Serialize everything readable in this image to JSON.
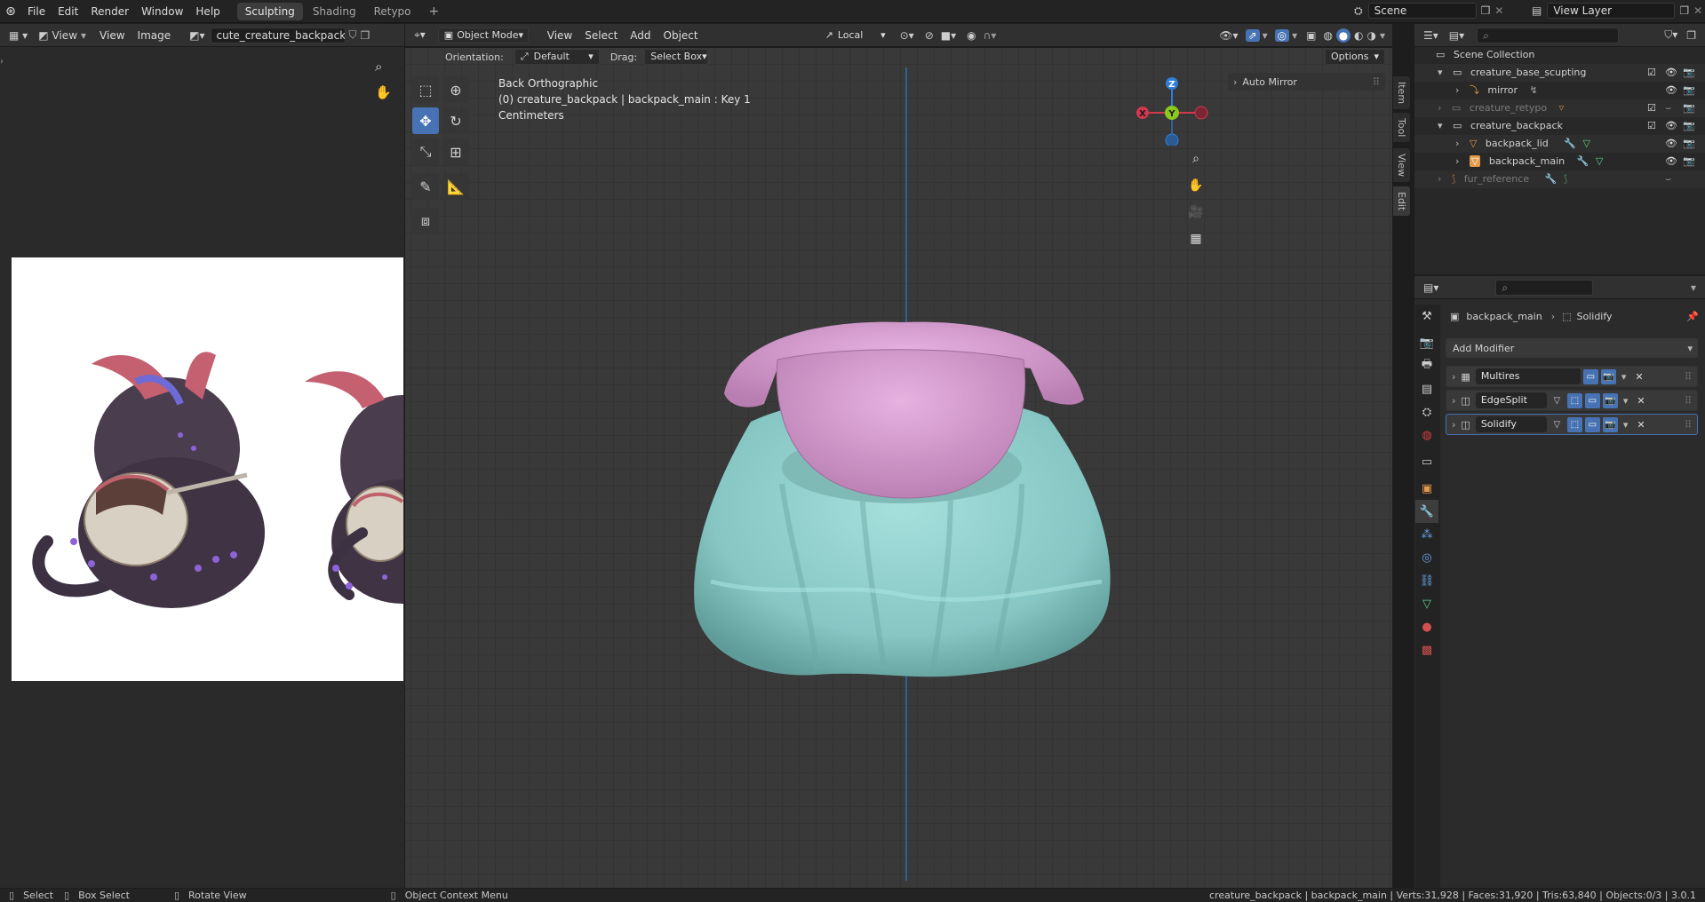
{
  "topbar": {
    "menus": [
      "File",
      "Edit",
      "Render",
      "Window",
      "Help"
    ],
    "workspaces": [
      {
        "label": "Sculpting",
        "active": true
      },
      {
        "label": "Shading",
        "active": false
      },
      {
        "label": "Retypo",
        "active": false
      }
    ],
    "add_workspace": "+",
    "scene_label": "Scene",
    "view_layer_label": "View Layer"
  },
  "image_editor": {
    "view_label": "View",
    "menus": [
      "View",
      "Image"
    ],
    "image_name": "cute_creature_backpack.jpg"
  },
  "viewport": {
    "mode_label": "Object Mode",
    "menus": [
      "View",
      "Select",
      "Add",
      "Object"
    ],
    "transform_space": "Local",
    "orientation_label": "Orientation:",
    "orientation_value": "Default",
    "drag_label": "Drag:",
    "drag_value": "Select Box",
    "options_label": "Options",
    "info_line1": "Back Orthographic",
    "info_line2": "(0) creature_backpack | backpack_main : Key 1",
    "info_line3": "Centimeters",
    "auto_mirror": "Auto Mirror",
    "gizmo_axes": {
      "z": "Z",
      "y": "Y",
      "x": "X"
    },
    "side_tabs": [
      "Item",
      "Tool",
      "View",
      "Edit"
    ]
  },
  "outliner": {
    "root": "Scene Collection",
    "rows": [
      {
        "label": "creature_base_scupting",
        "level": 1,
        "expanded": true,
        "dim": false
      },
      {
        "label": "mirror",
        "level": 2,
        "expanded": false,
        "dim": false
      },
      {
        "label": "creature_retypo",
        "level": 1,
        "expanded": false,
        "dim": true
      },
      {
        "label": "creature_backpack",
        "level": 1,
        "expanded": true,
        "dim": false
      },
      {
        "label": "backpack_lid",
        "level": 2,
        "expanded": false,
        "dim": false
      },
      {
        "label": "backpack_main",
        "level": 2,
        "expanded": false,
        "dim": false
      },
      {
        "label": "fur_reference",
        "level": 1,
        "expanded": false,
        "dim": true
      }
    ]
  },
  "properties": {
    "breadcrumb_object": "backpack_main",
    "breadcrumb_modifier": "Solidify",
    "add_modifier": "Add Modifier",
    "modifiers": [
      {
        "name": "Multires",
        "selected": false
      },
      {
        "name": "EdgeSplit",
        "selected": false
      },
      {
        "name": "Solidify",
        "selected": true
      }
    ]
  },
  "statusbar": {
    "select": "Select",
    "box_select": "Box Select",
    "rotate_view": "Rotate View",
    "context_menu": "Object Context Menu",
    "stats": "creature_backpack | backpack_main | Verts:31,928 | Faces:31,920 | Tris:63,840 | Objects:0/3 | 3.0.1"
  },
  "colors": {
    "accent": "#4772b3",
    "lid": "#d79bd2",
    "bag": "#8fcfcc",
    "axis_x": "#d2384f",
    "axis_y": "#8ac81e",
    "axis_z": "#2f7fd8"
  }
}
